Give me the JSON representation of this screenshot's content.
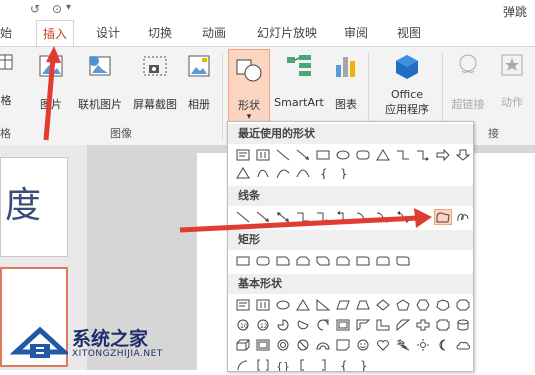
{
  "titlebar": {
    "right_text": "弹跳动"
  },
  "tabs": [
    "开始",
    "插入",
    "设计",
    "切换",
    "动画",
    "幻灯片放映",
    "审阅",
    "视图"
  ],
  "ribbon": {
    "buttons": {
      "format": "格",
      "picture": "图片",
      "online_picture": "联机图片",
      "screenshot": "屏幕截图",
      "album": "相册",
      "shapes": "形状",
      "smartart": "SmartArt",
      "chart": "图表",
      "office": "Office",
      "office_sub": "应用程序",
      "hyperlink": "超链接",
      "action": "动作"
    },
    "groups": {
      "tables": "格",
      "images": "图像",
      "links": "接"
    }
  },
  "dropdown": {
    "sections": [
      "最近使用的形状",
      "线条",
      "矩形",
      "基本形状"
    ]
  },
  "slide": {
    "title_char": "度"
  },
  "watermark": {
    "title": "系统之家",
    "url": "XITONGZHIJIA.NET"
  },
  "colors": {
    "accent": "#c43e1c",
    "arrow": "#e03c31",
    "highlight": "#fbd5c2"
  }
}
